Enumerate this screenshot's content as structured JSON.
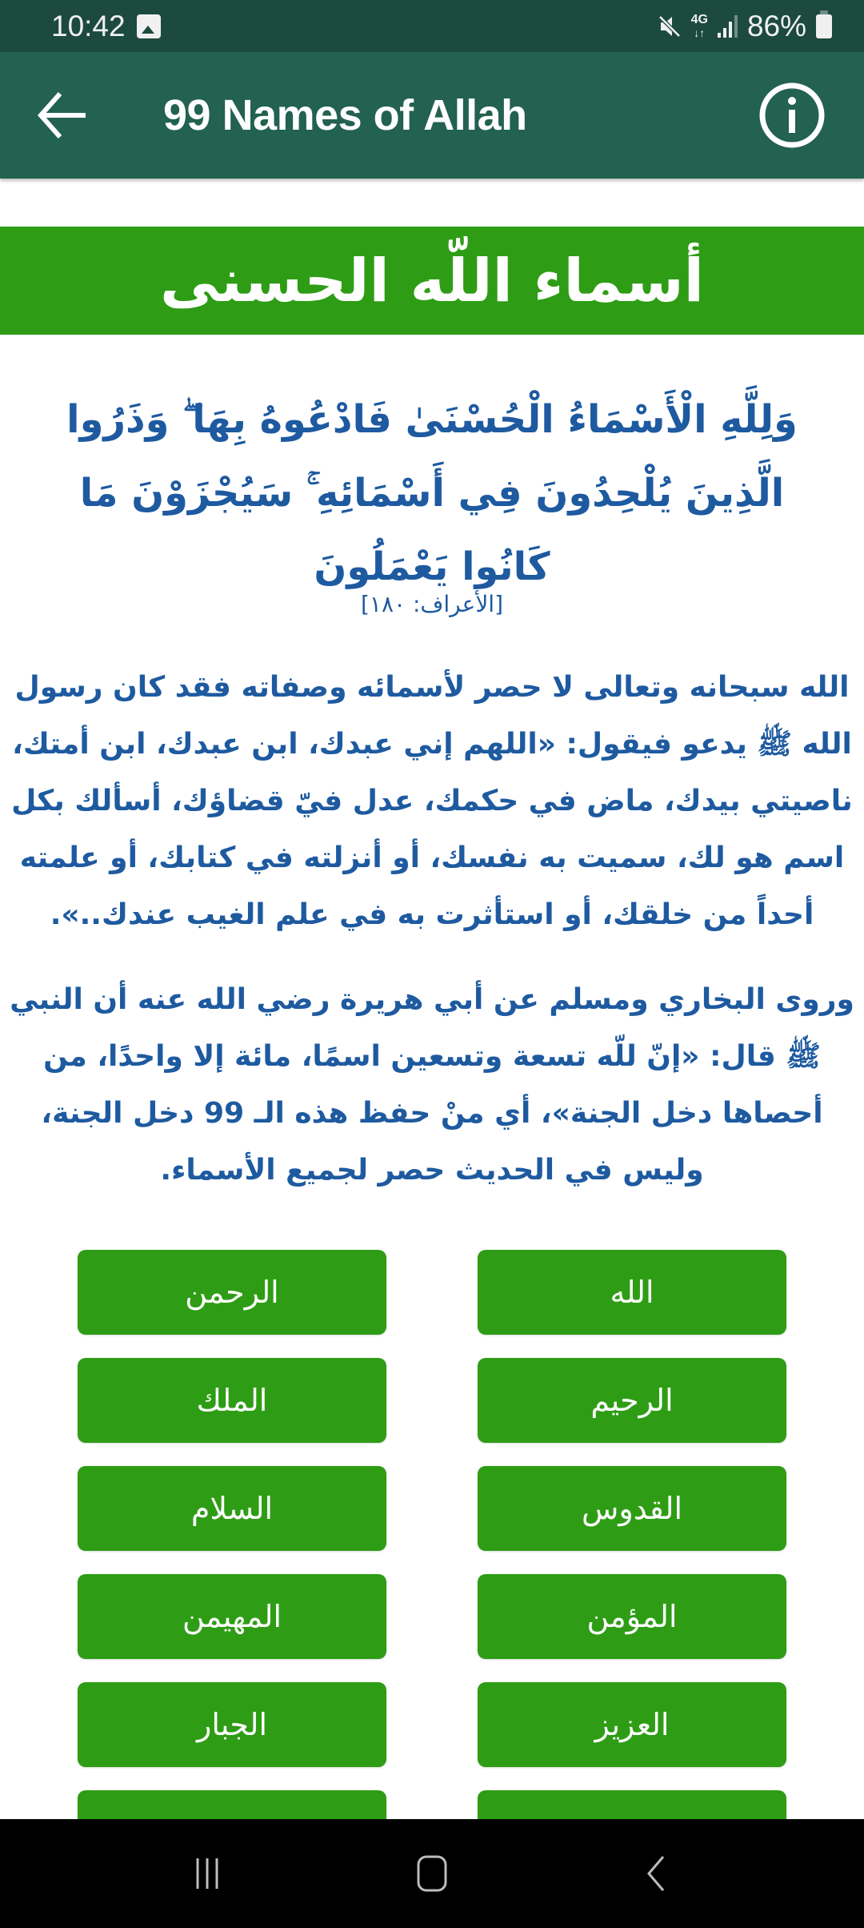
{
  "status_bar": {
    "time": "10:42",
    "network": "4G",
    "battery": "86%",
    "icons": [
      "gallery-icon",
      "mute-icon",
      "network-4g-icon",
      "signal-icon",
      "battery-icon"
    ]
  },
  "app_bar": {
    "title": "99 Names of Allah",
    "back_icon": "arrow-left-icon",
    "info_icon": "info-icon"
  },
  "banner": {
    "title": "أسماء اللّه الحسنى"
  },
  "verse": {
    "text": "وَلِلَّهِ الْأَسْمَاءُ الْحُسْنَىٰ فَادْعُوهُ بِهَا ۖ وَذَرُوا الَّذِينَ يُلْحِدُونَ فِي أَسْمَائِهِ ۚ سَيُجْزَوْنَ مَا كَانُوا يَعْمَلُونَ",
    "reference": "[الأعراف: ١٨٠]"
  },
  "paragraphs": [
    "الله سبحانه وتعالى لا حصر لأسمائه وصفاته فقد كان رسول الله ﷺ يدعو فيقول: «اللهم إني عبدك، ابن عبدك، ابن أمتك، ناصيتي بيدك، ماض في حكمك، عدل فيّ قضاؤك، أسألك بكل اسم هو لك، سميت به نفسك، أو أنزلته في كتابك، أو علمته أحداً من خلقك، أو استأثرت به في علم الغيب عندك..».",
    "وروى البخاري ومسلم عن أبي هريرة رضي الله عنه أن النبي ﷺ قال: «إنّ للّه تسعة وتسعين اسمًا، مائة إلا واحدًا، من أحصاها دخل الجنة»، أي منْ حفظ هذه الـ 99 دخل الجنة، وليس في الحديث حصر لجميع الأسماء."
  ],
  "names": [
    "الله",
    "الرحمن",
    "الرحيم",
    "الملك",
    "القدوس",
    "السلام",
    "المؤمن",
    "المهيمن",
    "العزيز",
    "الجبار",
    "",
    ""
  ],
  "nav_bar": {
    "recents": "recent-apps-icon",
    "home": "home-icon",
    "back": "back-chevron-icon"
  },
  "colors": {
    "status_bar": "#1c4a3e",
    "app_bar": "#236150",
    "accent_green": "#2e9d15",
    "text_blue": "#1e5aa0"
  }
}
